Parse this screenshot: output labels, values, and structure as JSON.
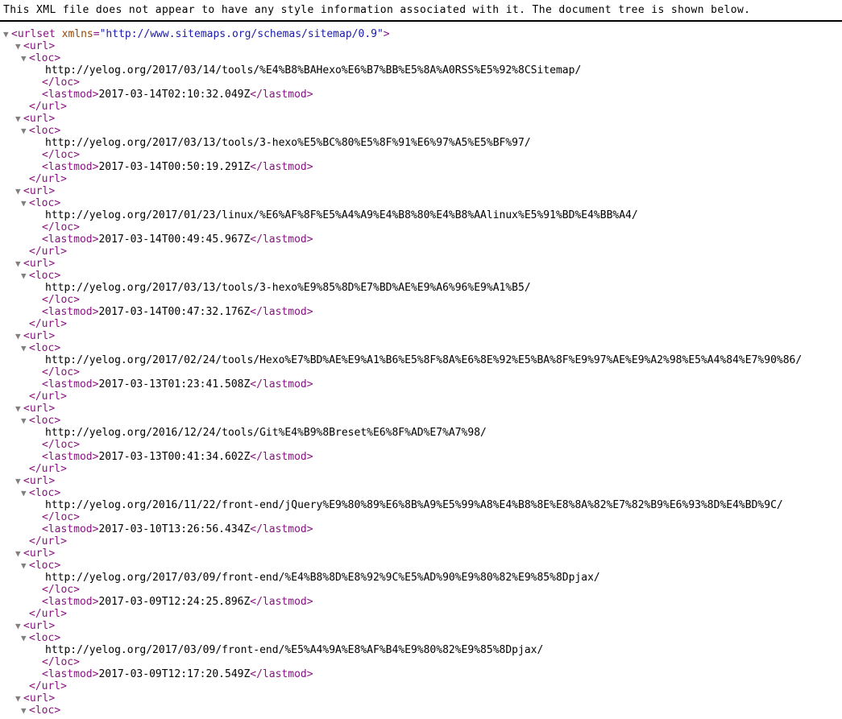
{
  "notice": "This XML file does not appear to have any style information associated with it. The document tree is shown below.",
  "icons": {
    "twisty_open": "▼"
  },
  "colors": {
    "tag": "#881280",
    "attribute_name": "#994500",
    "attribute_value": "#1a1aa6",
    "text": "#000000",
    "twisty": "#808080",
    "background": "#ffffff",
    "rule": "#000000"
  },
  "document": {
    "root_tag": "urlset",
    "root_attr_name": "xmlns",
    "root_attr_value": "http://www.sitemaps.org/schemas/sitemap/0.9",
    "url_tag": "url",
    "loc_tag": "loc",
    "lastmod_tag": "lastmod",
    "entries": [
      {
        "loc": "http://yelog.org/2017/03/14/tools/%E4%B8%BAHexo%E6%B7%BB%E5%8A%A0RSS%E5%92%8CSitemap/",
        "lastmod": "2017-03-14T02:10:32.049Z"
      },
      {
        "loc": "http://yelog.org/2017/03/13/tools/3-hexo%E5%BC%80%E5%8F%91%E6%97%A5%E5%BF%97/",
        "lastmod": "2017-03-14T00:50:19.291Z"
      },
      {
        "loc": "http://yelog.org/2017/01/23/linux/%E6%AF%8F%E5%A4%A9%E4%B8%80%E4%B8%AAlinux%E5%91%BD%E4%BB%A4/",
        "lastmod": "2017-03-14T00:49:45.967Z"
      },
      {
        "loc": "http://yelog.org/2017/03/13/tools/3-hexo%E9%85%8D%E7%BD%AE%E9%A6%96%E9%A1%B5/",
        "lastmod": "2017-03-14T00:47:32.176Z"
      },
      {
        "loc": "http://yelog.org/2017/02/24/tools/Hexo%E7%BD%AE%E9%A1%B6%E5%8F%8A%E6%8E%92%E5%BA%8F%E9%97%AE%E9%A2%98%E5%A4%84%E7%90%86/",
        "lastmod": "2017-03-13T01:23:41.508Z"
      },
      {
        "loc": "http://yelog.org/2016/12/24/tools/Git%E4%B9%8Breset%E6%8F%AD%E7%A7%98/",
        "lastmod": "2017-03-13T00:41:34.602Z"
      },
      {
        "loc": "http://yelog.org/2016/11/22/front-end/jQuery%E9%80%89%E6%8B%A9%E5%99%A8%E4%B8%8E%E8%8A%82%E7%82%B9%E6%93%8D%E4%BD%9C/",
        "lastmod": "2017-03-10T13:26:56.434Z"
      },
      {
        "loc": "http://yelog.org/2017/03/09/front-end/%E4%B8%8D%E8%92%9C%E5%AD%90%E9%80%82%E9%85%8Dpjax/",
        "lastmod": "2017-03-09T12:24:25.896Z"
      },
      {
        "loc": "http://yelog.org/2017/03/09/front-end/%E5%A4%9A%E8%AF%B4%E9%80%82%E9%85%8Dpjax/",
        "lastmod": "2017-03-09T12:17:20.549Z"
      }
    ],
    "partial_entry": {
      "url_tag": "url",
      "loc_tag": "loc"
    }
  }
}
